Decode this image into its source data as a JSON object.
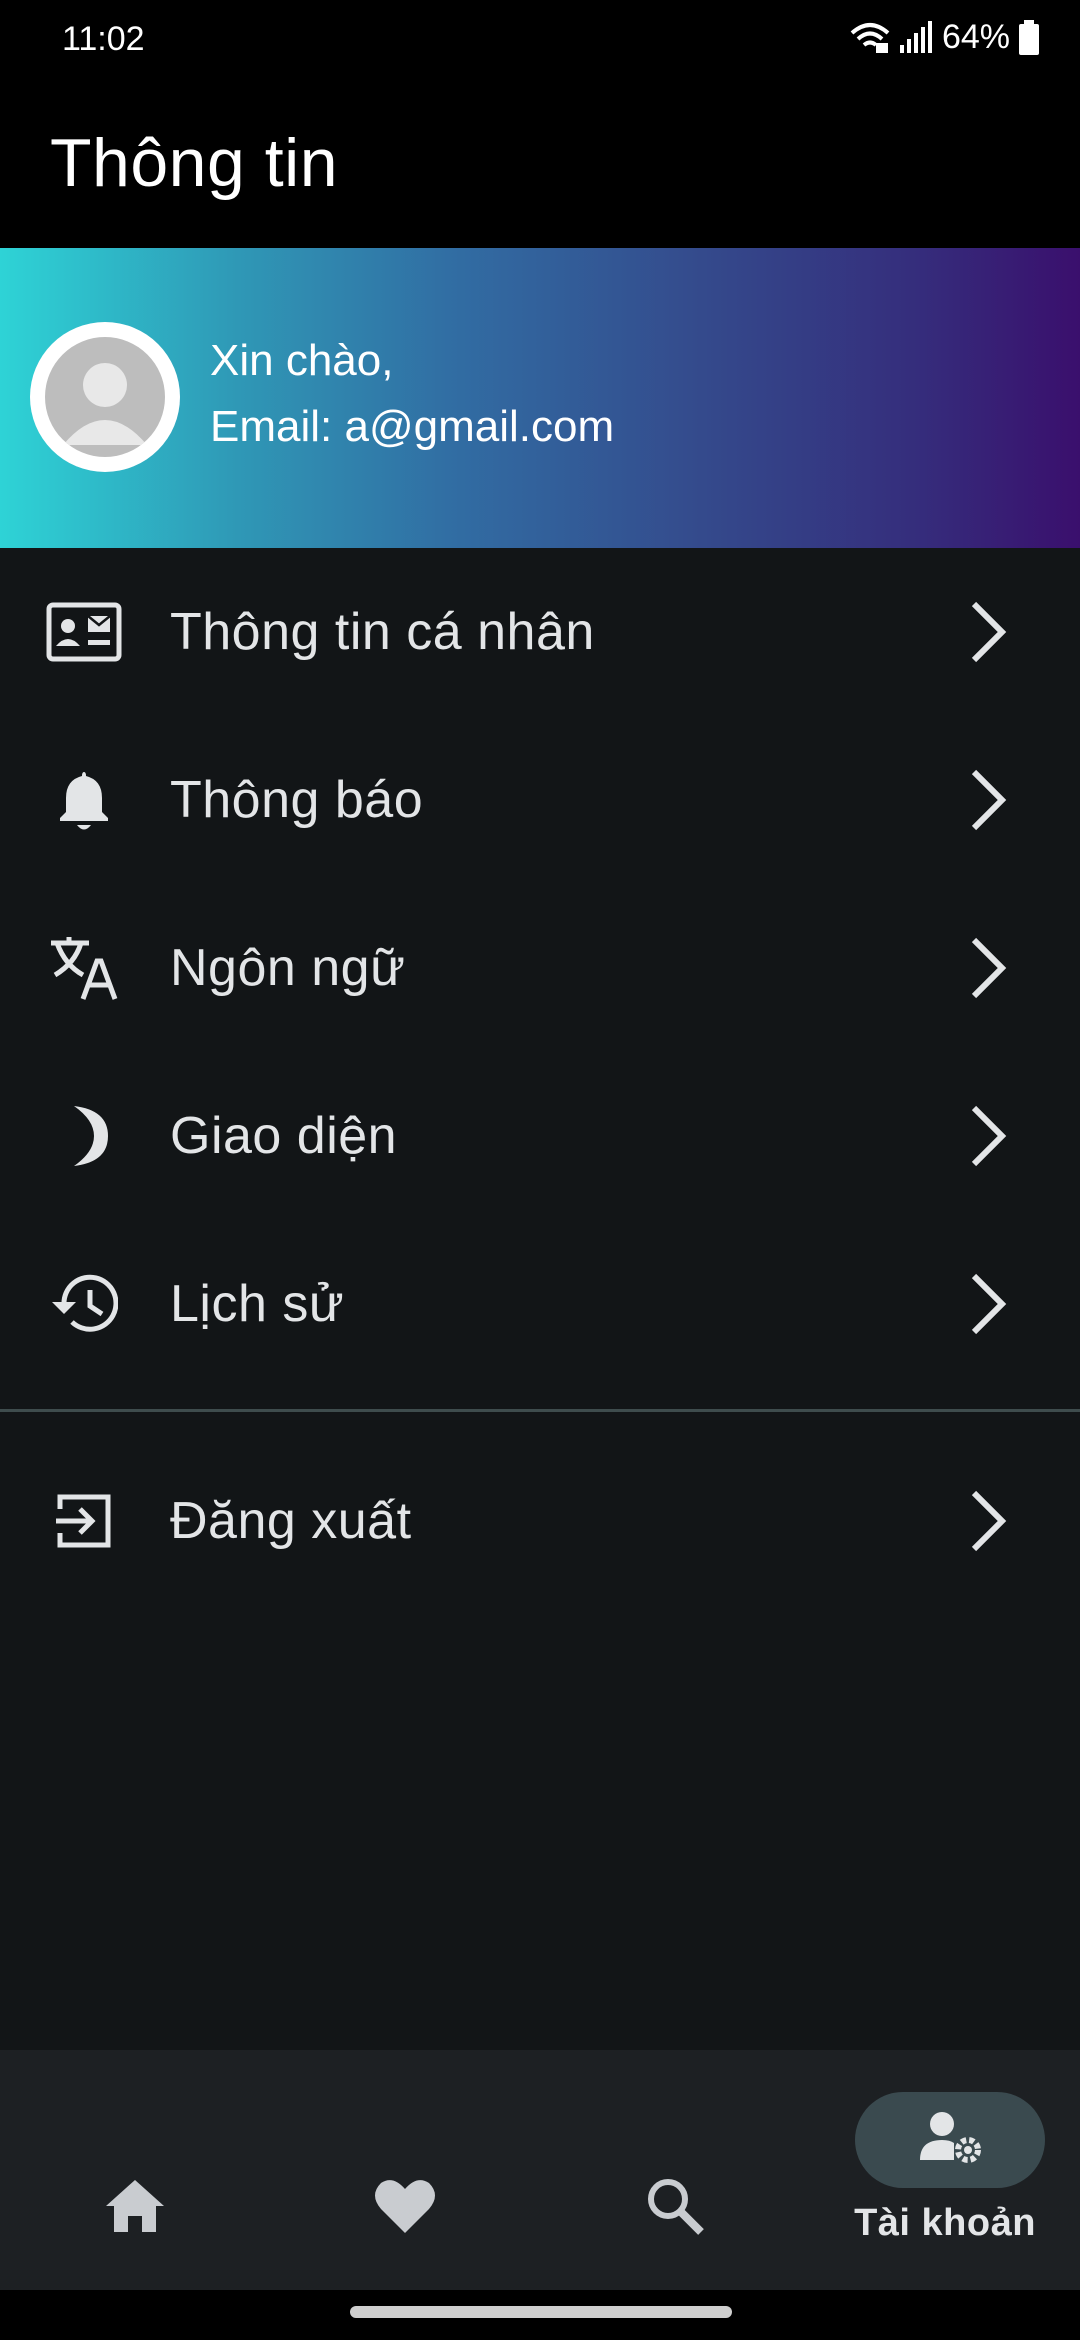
{
  "status_bar": {
    "time": "11:02",
    "battery": "64%"
  },
  "header": {
    "title": "Thông tin"
  },
  "profile": {
    "greeting": "Xin chào,",
    "email": "Email: a@gmail.com"
  },
  "menu": {
    "items": [
      {
        "label": "Thông tin cá nhân",
        "icon": "contact-card-icon"
      },
      {
        "label": "Thông báo",
        "icon": "bell-icon"
      },
      {
        "label": "Ngôn ngữ",
        "icon": "translate-icon"
      },
      {
        "label": "Giao diện",
        "icon": "moon-icon"
      },
      {
        "label": "Lịch sử",
        "icon": "history-icon"
      }
    ],
    "logout": {
      "label": "Đăng xuất",
      "icon": "logout-icon"
    }
  },
  "bottom_nav": {
    "items": [
      {
        "icon": "home-icon",
        "label": ""
      },
      {
        "icon": "heart-icon",
        "label": ""
      },
      {
        "icon": "search-icon",
        "label": ""
      },
      {
        "icon": "account-settings-icon",
        "label": "Tài khoản",
        "active": true
      }
    ]
  },
  "colors": {
    "background": "#121517",
    "banner_start": "#2ed3d6",
    "banner_end": "#3a0f6d",
    "nav_background": "#1d2023",
    "active_pill": "#3a4a4f",
    "text": "#e3e5e7"
  }
}
